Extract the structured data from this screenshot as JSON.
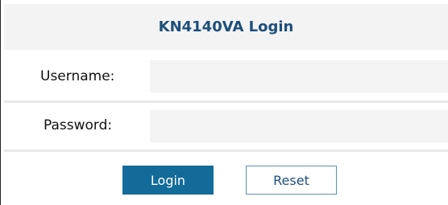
{
  "header": {
    "title": "KN4140VA Login"
  },
  "form": {
    "username_label": "Username:",
    "username_value": "",
    "password_label": "Password:",
    "password_value": ""
  },
  "buttons": {
    "login_label": "Login",
    "reset_label": "Reset"
  },
  "colors": {
    "title": "#1d4f7c",
    "login_button_bg": "#136b9a",
    "reset_button_border": "#5a8fb5"
  }
}
